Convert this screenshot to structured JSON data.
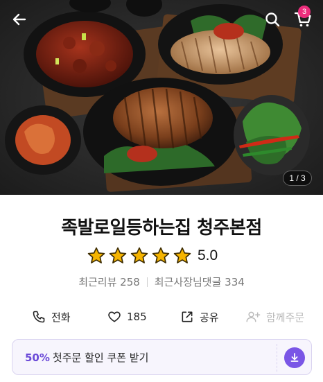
{
  "hero": {
    "page_counter": "1 / 3"
  },
  "header": {
    "back_icon": "arrow-left-icon",
    "search_icon": "search-icon",
    "cart_icon": "cart-icon",
    "cart_count": "3"
  },
  "store": {
    "name": "족발로일등하는집 청주본점",
    "rating": "5.0",
    "stars_filled": 5,
    "stars_total": 5,
    "recent_reviews": "최근리뷰 258",
    "recent_owner_replies": "최근사장님댓글 334"
  },
  "actions": {
    "call_label": "전화",
    "like_count": "185",
    "share_label": "공유",
    "group_order_label": "함께주문"
  },
  "coupon": {
    "percent": "50%",
    "text": "첫주문 할인 쿠폰 받기"
  },
  "colors": {
    "accent": "#7a56e6",
    "coupon_percent": "#6b4ad8",
    "badge": "#ec2d7c",
    "star": "#f5b400"
  }
}
